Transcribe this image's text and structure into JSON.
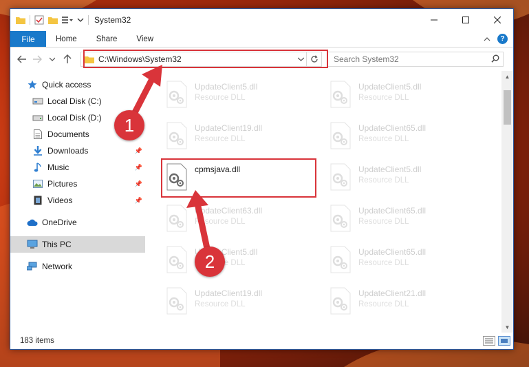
{
  "window": {
    "title": "System32",
    "controls": {
      "minimize_icon": "minimize-icon",
      "maximize_icon": "maximize-icon",
      "close_icon": "close-icon"
    }
  },
  "ribbon": {
    "file_tab": "File",
    "tabs": [
      "Home",
      "Share",
      "View"
    ]
  },
  "navbar": {
    "address_path": "C:\\Windows\\System32",
    "search_placeholder": "Search System32"
  },
  "sidebar": {
    "items": [
      {
        "label": "Quick access",
        "icon": "star-icon",
        "pinned": false
      },
      {
        "label": "Local Disk (C:)",
        "icon": "drive-icon",
        "pinned": false
      },
      {
        "label": "Local Disk (D:)",
        "icon": "drive-icon",
        "pinned": false
      },
      {
        "label": "Documents",
        "icon": "documents-icon",
        "pinned": true
      },
      {
        "label": "Downloads",
        "icon": "download-icon",
        "pinned": true
      },
      {
        "label": "Music",
        "icon": "music-icon",
        "pinned": true
      },
      {
        "label": "Pictures",
        "icon": "pictures-icon",
        "pinned": true
      },
      {
        "label": "Videos",
        "icon": "videos-icon",
        "pinned": true
      },
      {
        "label": "OneDrive",
        "icon": "cloud-icon",
        "pinned": false
      },
      {
        "label": "This PC",
        "icon": "computer-icon",
        "pinned": false,
        "selected": true
      },
      {
        "label": "Network",
        "icon": "network-icon",
        "pinned": false
      }
    ]
  },
  "files": {
    "highlighted": {
      "name": "cpmsjava.dll"
    },
    "left_column": [
      {
        "name": "UpdateClient5.dll",
        "desc": "Resource DLL"
      },
      {
        "name": "UpdateClient19.dll",
        "desc": "Resource DLL"
      },
      {
        "name": "UpdateClient63.dll",
        "desc": "Resource DLL"
      },
      {
        "name": "UpdateClient5.dll",
        "desc": "Resource DLL"
      },
      {
        "name": "UpdateClient19.dll",
        "desc": "Resource DLL"
      }
    ],
    "right_column": [
      {
        "name": "UpdateClient5.dll",
        "desc": "Resource DLL"
      },
      {
        "name": "UpdateClient65.dll",
        "desc": "Resource DLL"
      },
      {
        "name": "UpdateClient5.dll",
        "desc": "Resource DLL"
      },
      {
        "name": "UpdateClient65.dll",
        "desc": "Resource DLL"
      },
      {
        "name": "UpdateClient65.dll",
        "desc": "Resource DLL"
      },
      {
        "name": "UpdateClient21.dll",
        "desc": "Resource DLL"
      }
    ]
  },
  "status": {
    "item_count": "183 items"
  },
  "annotations": {
    "step1": "1",
    "step2": "2",
    "color": "#d9343a"
  }
}
